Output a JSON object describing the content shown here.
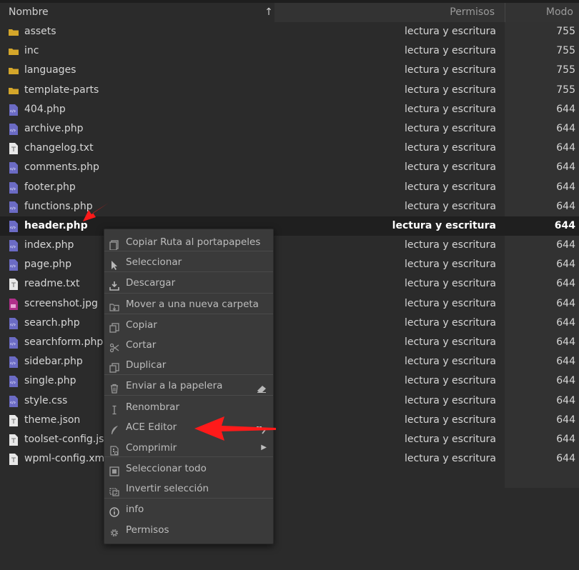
{
  "header": {
    "name": "Nombre",
    "permissions": "Permisos",
    "mode": "Modo"
  },
  "files": [
    {
      "name": "assets",
      "type": "folder",
      "perm": "lectura y escritura",
      "mode": "755"
    },
    {
      "name": "inc",
      "type": "folder",
      "perm": "lectura y escritura",
      "mode": "755"
    },
    {
      "name": "languages",
      "type": "folder",
      "perm": "lectura y escritura",
      "mode": "755"
    },
    {
      "name": "template-parts",
      "type": "folder",
      "perm": "lectura y escritura",
      "mode": "755"
    },
    {
      "name": "404.php",
      "type": "php",
      "perm": "lectura y escritura",
      "mode": "644"
    },
    {
      "name": "archive.php",
      "type": "php",
      "perm": "lectura y escritura",
      "mode": "644"
    },
    {
      "name": "changelog.txt",
      "type": "txt",
      "perm": "lectura y escritura",
      "mode": "644"
    },
    {
      "name": "comments.php",
      "type": "php",
      "perm": "lectura y escritura",
      "mode": "644"
    },
    {
      "name": "footer.php",
      "type": "php",
      "perm": "lectura y escritura",
      "mode": "644"
    },
    {
      "name": "functions.php",
      "type": "php",
      "perm": "lectura y escritura",
      "mode": "644"
    },
    {
      "name": "header.php",
      "type": "php",
      "perm": "lectura y escritura",
      "mode": "644",
      "selected": true
    },
    {
      "name": "index.php",
      "type": "php",
      "perm": "lectura y escritura",
      "mode": "644"
    },
    {
      "name": "page.php",
      "type": "php",
      "perm": "lectura y escritura",
      "mode": "644"
    },
    {
      "name": "readme.txt",
      "type": "txt",
      "perm": "lectura y escritura",
      "mode": "644"
    },
    {
      "name": "screenshot.jpg",
      "type": "img",
      "perm": "lectura y escritura",
      "mode": "644"
    },
    {
      "name": "search.php",
      "type": "php",
      "perm": "lectura y escritura",
      "mode": "644"
    },
    {
      "name": "searchform.php",
      "type": "php",
      "perm": "lectura y escritura",
      "mode": "644"
    },
    {
      "name": "sidebar.php",
      "type": "php",
      "perm": "lectura y escritura",
      "mode": "644"
    },
    {
      "name": "single.php",
      "type": "php",
      "perm": "lectura y escritura",
      "mode": "644"
    },
    {
      "name": "style.css",
      "type": "php",
      "perm": "lectura y escritura",
      "mode": "644"
    },
    {
      "name": "theme.json",
      "type": "txt",
      "perm": "lectura y escritura",
      "mode": "644"
    },
    {
      "name": "toolset-config.json",
      "type": "txt",
      "perm": "lectura y escritura",
      "mode": "644"
    },
    {
      "name": "wpml-config.xml",
      "type": "txt",
      "perm": "lectura y escritura",
      "mode": "644"
    }
  ],
  "context_menu": {
    "items": [
      {
        "label": "Copiar Ruta al portapapeles",
        "icon": "copy-path-icon"
      },
      {
        "label": "Seleccionar",
        "icon": "pointer-icon"
      },
      {
        "label": "Descargar",
        "icon": "download-icon"
      },
      {
        "label": "Mover a una nueva carpeta",
        "icon": "move-folder-icon"
      },
      {
        "label": "Copiar",
        "icon": "copy-icon"
      },
      {
        "label": "Cortar",
        "icon": "scissors-icon"
      },
      {
        "label": "Duplicar",
        "icon": "duplicate-icon"
      },
      {
        "label": "Enviar a la papelera",
        "icon": "trash-icon"
      },
      {
        "label": "Renombrar",
        "icon": "text-cursor-icon"
      },
      {
        "label": "ACE Editor",
        "icon": "feather-icon"
      },
      {
        "label": "Comprimir",
        "icon": "archive-icon"
      },
      {
        "label": "Seleccionar todo",
        "icon": "select-all-icon"
      },
      {
        "label": "Invertir selección",
        "icon": "invert-selection-icon"
      },
      {
        "label": "info",
        "icon": "info-icon"
      },
      {
        "label": "Permisos",
        "icon": "gear-icon"
      }
    ]
  },
  "colors": {
    "folder": "#d4a62a",
    "php": "#6b6bc4",
    "img": "#b0308a",
    "txt": "#e8e8e8",
    "annotation": "#ff1a1a"
  }
}
